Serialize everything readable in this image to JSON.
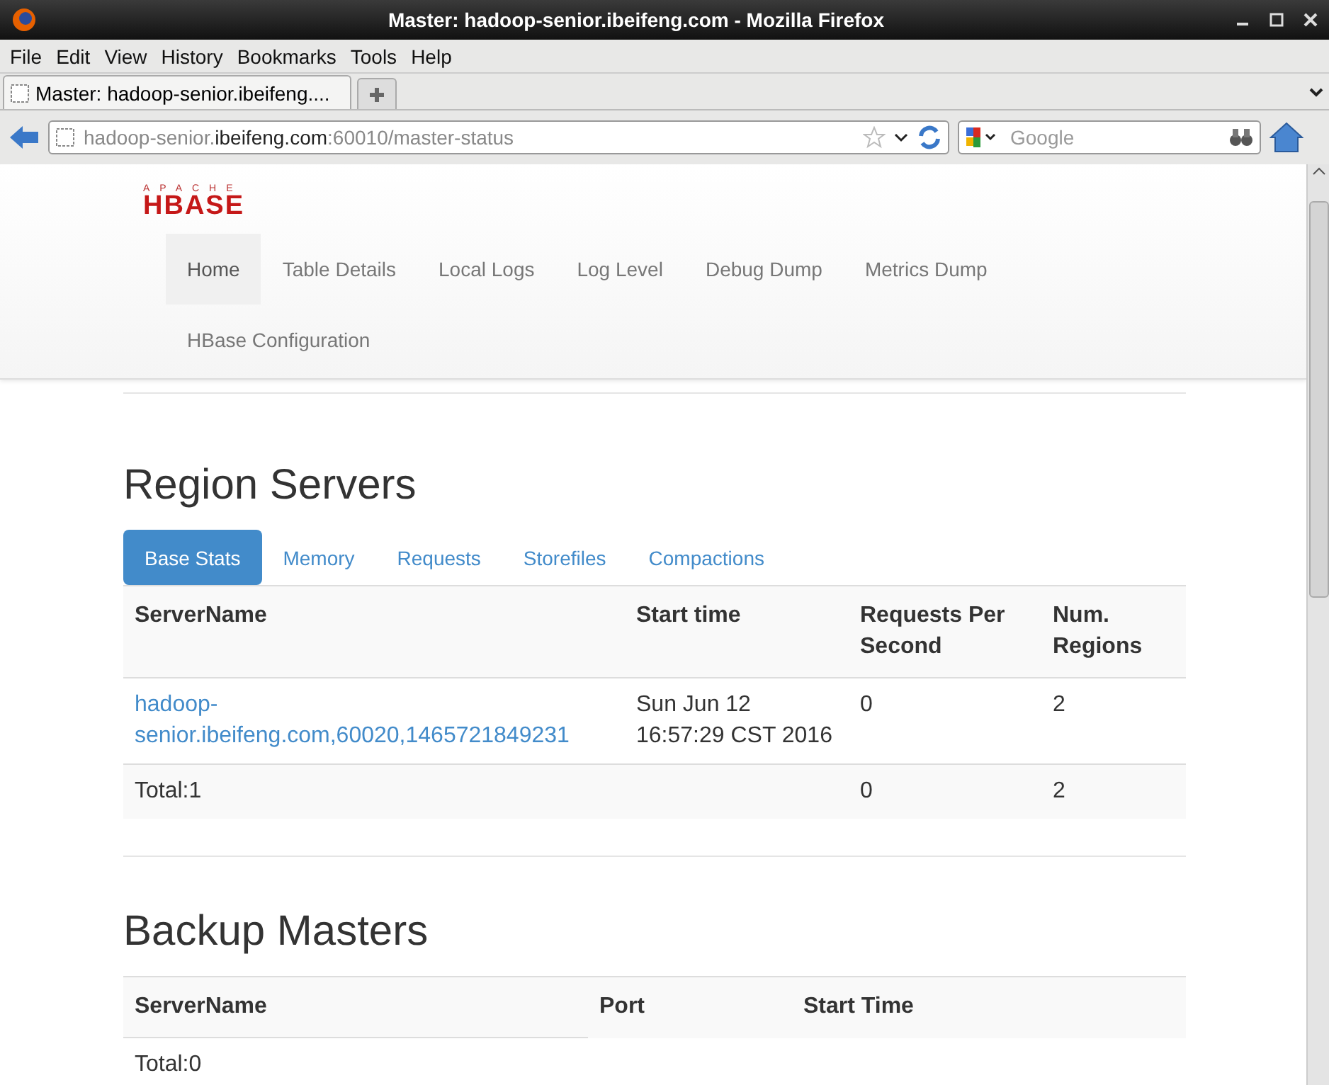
{
  "window": {
    "title": "Master: hadoop-senior.ibeifeng.com - Mozilla Firefox"
  },
  "menu": [
    "File",
    "Edit",
    "View",
    "History",
    "Bookmarks",
    "Tools",
    "Help"
  ],
  "browser_tabs": [
    {
      "label": "Master: hadoop-senior.ibeifeng....",
      "selected": true
    }
  ],
  "address_bar": {
    "prefix": "hadoop-senior.",
    "domain": "ibeifeng.com",
    "suffix": ":60010/master-status"
  },
  "search": {
    "placeholder": "Google"
  },
  "logo": {
    "top": "APACHE",
    "main": "HBASE"
  },
  "nav": [
    {
      "label": "Home",
      "selected": true
    },
    {
      "label": "Table Details",
      "selected": false
    },
    {
      "label": "Local Logs",
      "selected": false
    },
    {
      "label": "Log Level",
      "selected": false
    },
    {
      "label": "Debug Dump",
      "selected": false
    },
    {
      "label": "Metrics Dump",
      "selected": false
    },
    {
      "label": "HBase Configuration",
      "selected": false
    }
  ],
  "region_servers": {
    "title": "Region Servers",
    "tabs": [
      {
        "label": "Base Stats",
        "selected": true
      },
      {
        "label": "Memory",
        "selected": false
      },
      {
        "label": "Requests",
        "selected": false
      },
      {
        "label": "Storefiles",
        "selected": false
      },
      {
        "label": "Compactions",
        "selected": false
      }
    ],
    "columns": [
      "ServerName",
      "Start time",
      "Requests Per Second",
      "Num. Regions"
    ],
    "rows": [
      [
        "hadoop-senior.ibeifeng.com,60020,1465721849231",
        "Sun Jun 12 16:57:29 CST 2016",
        "0",
        "2"
      ]
    ],
    "total": {
      "label": "Total:1",
      "requests": "0",
      "regions": "2"
    }
  },
  "backup_masters": {
    "title": "Backup Masters",
    "columns": [
      "ServerName",
      "Port",
      "Start Time"
    ],
    "total": "Total:0"
  }
}
